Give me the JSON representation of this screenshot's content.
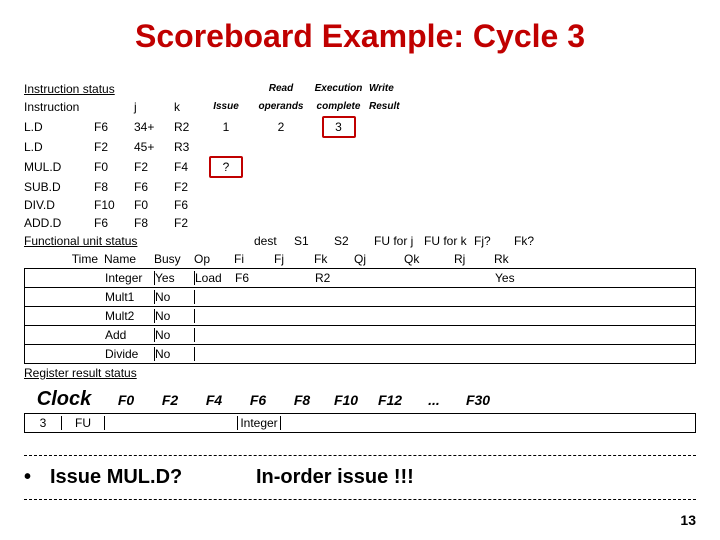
{
  "title": "Scoreboard Example:  Cycle 3",
  "instr_status": {
    "header": "Instruction status",
    "cols": {
      "instr": "Instruction",
      "j": "j",
      "k": "k",
      "issue": "Issue",
      "read": "Read",
      "read2": "operands",
      "exec": "Execution",
      "exec2": "complete",
      "write": "Write",
      "write2": "Result"
    },
    "rows": [
      {
        "op": "L.D",
        "d": "F6",
        "j": "34+",
        "k": "R2",
        "issue": "1",
        "read": "2",
        "exec": "3",
        "write": ""
      },
      {
        "op": "L.D",
        "d": "F2",
        "j": "45+",
        "k": "R3",
        "issue": "",
        "read": "",
        "exec": "",
        "write": ""
      },
      {
        "op": "MUL.D",
        "d": "F0",
        "j": "F2",
        "k": "F4",
        "issue": "?",
        "read": "",
        "exec": "",
        "write": ""
      },
      {
        "op": "SUB.D",
        "d": "F8",
        "j": "F6",
        "k": "F2",
        "issue": "",
        "read": "",
        "exec": "",
        "write": ""
      },
      {
        "op": "DIV.D",
        "d": "F10",
        "j": "F0",
        "k": "F6",
        "issue": "",
        "read": "",
        "exec": "",
        "write": ""
      },
      {
        "op": "ADD.D",
        "d": "F6",
        "j": "F8",
        "k": "F2",
        "issue": "",
        "read": "",
        "exec": "",
        "write": ""
      }
    ]
  },
  "fu_status": {
    "header": "Functional unit status",
    "cols": {
      "time": "Time",
      "name": "Name",
      "busy": "Busy",
      "op": "Op",
      "fi": "dest",
      "fi2": "Fi",
      "fj": "S1",
      "fj2": "Fj",
      "fk": "S2",
      "fk2": "Fk",
      "qj": "FU for j",
      "qj2": "Qj",
      "qk": "FU for k",
      "qk2": "Qk",
      "rj": "Fj?",
      "rj2": "Rj",
      "rk": "Fk?",
      "rk2": "Rk"
    },
    "rows": [
      {
        "name": "Integer",
        "busy": "Yes",
        "op": "Load",
        "fi": "F6",
        "fj": "",
        "fk": "R2",
        "qj": "",
        "qk": "",
        "rj": "",
        "rk": "Yes"
      },
      {
        "name": "Mult1",
        "busy": "No",
        "op": "",
        "fi": "",
        "fj": "",
        "fk": "",
        "qj": "",
        "qk": "",
        "rj": "",
        "rk": ""
      },
      {
        "name": "Mult2",
        "busy": "No",
        "op": "",
        "fi": "",
        "fj": "",
        "fk": "",
        "qj": "",
        "qk": "",
        "rj": "",
        "rk": ""
      },
      {
        "name": "Add",
        "busy": "No",
        "op": "",
        "fi": "",
        "fj": "",
        "fk": "",
        "qj": "",
        "qk": "",
        "rj": "",
        "rk": ""
      },
      {
        "name": "Divide",
        "busy": "No",
        "op": "",
        "fi": "",
        "fj": "",
        "fk": "",
        "qj": "",
        "qk": "",
        "rj": "",
        "rk": ""
      }
    ]
  },
  "reg_status": {
    "header": "Register result status",
    "clock_label": "Clock",
    "clock": "3",
    "fu_label": "FU",
    "regs": [
      "F0",
      "F2",
      "F4",
      "F6",
      "F8",
      "F10",
      "F12",
      "...",
      "F30"
    ],
    "vals": [
      "",
      "",
      "",
      "Integer",
      "",
      "",
      "",
      "",
      ""
    ]
  },
  "bullet": {
    "prefix": "•",
    "q": "Issue MUL.D?",
    "a": "In-order issue !!!"
  },
  "slide_num": "13"
}
